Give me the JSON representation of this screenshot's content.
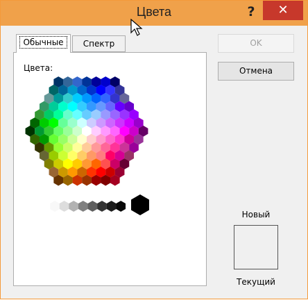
{
  "window": {
    "title": "Цвета",
    "help_label": "?",
    "close_label": "✕",
    "background": "#f0f0f0",
    "title_bar_color": "#f0a14a"
  },
  "tabs": [
    {
      "label": "Обычные",
      "active": true
    },
    {
      "label": "Спектр",
      "active": false
    }
  ],
  "panel": {
    "colors_label": "Цвета:"
  },
  "buttons": {
    "ok_label": "OK",
    "cancel_label": "Отмена"
  },
  "preview": {
    "new_label": "Новый",
    "current_label": "Текущий"
  },
  "palette": {
    "hex_rows": [
      [
        "#003366",
        "#336699",
        "#3366CC",
        "#003399",
        "#000099",
        "#0000CC",
        "#000066"
      ],
      [
        "#006666",
        "#006699",
        "#0099CC",
        "#0066CC",
        "#0033CC",
        "#0000FF",
        "#3333FF",
        "#333399"
      ],
      [
        "#669999",
        "#009999",
        "#33CCCC",
        "#00CCFF",
        "#0099FF",
        "#0066FF",
        "#3366FF",
        "#3333CC",
        "#666699"
      ],
      [
        "#339966",
        "#00CC99",
        "#00FFCC",
        "#00FFFF",
        "#33CCFF",
        "#3399FF",
        "#6699FF",
        "#6666FF",
        "#6600FF",
        "#6600CC"
      ],
      [
        "#339933",
        "#00CC66",
        "#00FF99",
        "#66FFCC",
        "#66FFFF",
        "#66CCFF",
        "#99CCFF",
        "#9999FF",
        "#9966FF",
        "#9933FF",
        "#9900FF"
      ],
      [
        "#006600",
        "#00CC00",
        "#00FF00",
        "#66FF99",
        "#99FFCC",
        "#CCFFFF",
        "#CCCCFF",
        "#CC99FF",
        "#CC66FF",
        "#CC33FF",
        "#CC00FF",
        "#9900CC"
      ],
      [
        "#003300",
        "#009933",
        "#33CC33",
        "#66FF66",
        "#99FF99",
        "#CCFFCC",
        "#FFFFFF",
        "#FFCCFF",
        "#FF99FF",
        "#FF66FF",
        "#FF00FF",
        "#CC00CC",
        "#660066"
      ],
      [
        "#336600",
        "#009900",
        "#66FF33",
        "#99FF66",
        "#CCFF99",
        "#FFFFCC",
        "#FFCCCC",
        "#FF99CC",
        "#FF66CC",
        "#FF33CC",
        "#CC0099",
        "#993399"
      ],
      [
        "#333300",
        "#669900",
        "#99FF33",
        "#CCFF66",
        "#FFFF99",
        "#FFCC99",
        "#FF9999",
        "#FF6699",
        "#FF3399",
        "#CC3399",
        "#990099"
      ],
      [
        "#666633",
        "#99CC00",
        "#CCFF33",
        "#FFFF66",
        "#FFCC66",
        "#FF9966",
        "#FF7C80",
        "#FF0066",
        "#D60093",
        "#993366"
      ],
      [
        "#808000",
        "#CCCC00",
        "#FFFF00",
        "#FFCC00",
        "#FF9933",
        "#FF6600",
        "#FF5050",
        "#CC0066",
        "#660033"
      ],
      [
        "#996633",
        "#CC9900",
        "#FF9900",
        "#CC6600",
        "#FF3300",
        "#FF0000",
        "#CC0000",
        "#990033"
      ],
      [
        "#663300",
        "#996600",
        "#CC3300",
        "#993300",
        "#990000",
        "#800000",
        "#A50021"
      ]
    ],
    "grays": [
      "#F8F8F8",
      "#DDDDDD",
      "#B2B2B2",
      "#808080",
      "#5F5F5F",
      "#333333",
      "#1C1C1C",
      "#080808"
    ],
    "black": "#000000"
  }
}
